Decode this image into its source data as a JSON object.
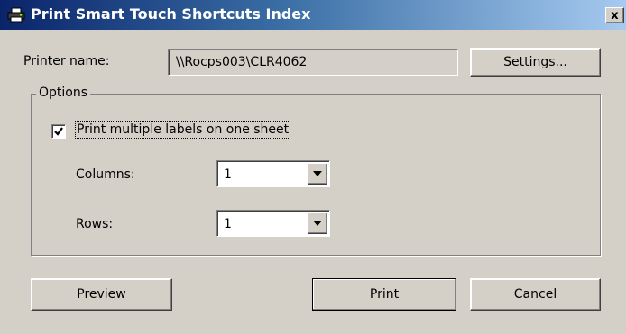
{
  "window": {
    "title": "Print Smart Touch Shortcuts Index",
    "close_glyph": "x"
  },
  "printer": {
    "label": "Printer name:",
    "value": "\\\\Rocps003\\CLR4062",
    "settings_label": "Settings..."
  },
  "options": {
    "legend": "Options",
    "multi_label": {
      "text": "Print multiple labels on one sheet",
      "checked": true
    },
    "columns": {
      "label": "Columns:",
      "value": "1"
    },
    "rows": {
      "label": "Rows:",
      "value": "1"
    }
  },
  "buttons": {
    "preview": "Preview",
    "print": "Print",
    "cancel": "Cancel"
  },
  "icons": {
    "title": "printer-icon",
    "checkbox": "checkmark-icon",
    "dropdown": "chevron-down-icon"
  },
  "colors": {
    "title_start": "#0a246a",
    "title_end": "#a6caf0",
    "face": "#d4d0c8"
  }
}
